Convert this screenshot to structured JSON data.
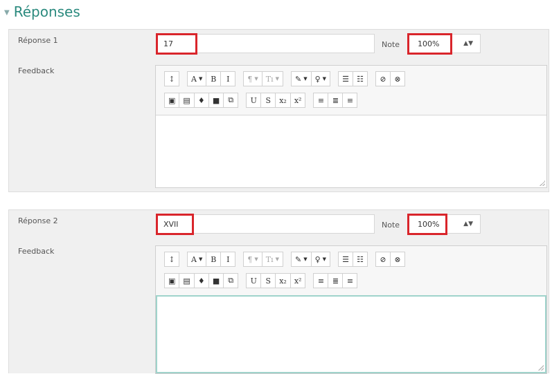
{
  "section": {
    "title": "Réponses"
  },
  "answers": [
    {
      "answer_label": "Réponse 1",
      "answer_value": "17",
      "grade_label": "Note",
      "grade_value": "100%",
      "feedback_label": "Feedback"
    },
    {
      "answer_label": "Réponse 2",
      "answer_value": "XVII",
      "grade_label": "Note",
      "grade_value": "100%",
      "feedback_label": "Feedback"
    }
  ],
  "toolbar": {
    "row1": [
      [
        "collapse-icon"
      ],
      [
        "font-size-icon",
        "bold-icon",
        "italic-icon"
      ],
      [
        "paragraph-style-icon",
        "text-style-icon"
      ],
      [
        "font-color-icon",
        "highlight-color-icon"
      ],
      [
        "bullet-list-icon",
        "numbered-list-icon"
      ],
      [
        "link-icon",
        "unlink-icon"
      ]
    ],
    "row2": [
      [
        "image-icon",
        "media-file-icon",
        "record-audio-icon",
        "record-video-icon",
        "manage-files-icon"
      ],
      [
        "underline-icon",
        "strikethrough-icon",
        "subscript-icon",
        "superscript-icon"
      ],
      [
        "align-left-icon",
        "align-center-icon",
        "align-right-icon"
      ]
    ],
    "glyphs": {
      "collapse-icon": "↕",
      "font-size-icon": "A",
      "bold-icon": "B",
      "italic-icon": "I",
      "paragraph-style-icon": "¶",
      "text-style-icon": "Tı",
      "font-color-icon": "✎",
      "highlight-color-icon": "♀",
      "bullet-list-icon": "☰",
      "numbered-list-icon": "☷",
      "link-icon": "⊘",
      "unlink-icon": "⊗",
      "image-icon": "▣",
      "media-file-icon": "▤",
      "record-audio-icon": "♦",
      "record-video-icon": "■",
      "manage-files-icon": "⧉",
      "underline-icon": "U",
      "strikethrough-icon": "S",
      "subscript-icon": "x₂",
      "superscript-icon": "x²",
      "align-left-icon": "≡",
      "align-center-icon": "≣",
      "align-right-icon": "≡"
    },
    "dropdowns": [
      "font-size-icon",
      "paragraph-style-icon",
      "text-style-icon",
      "font-color-icon",
      "highlight-color-icon"
    ],
    "muted": [
      "paragraph-style-icon",
      "text-style-icon"
    ]
  },
  "colors": {
    "accent": "#2b8a7e",
    "highlight_box": "#d9252b",
    "focus": "#9fd3cb"
  }
}
